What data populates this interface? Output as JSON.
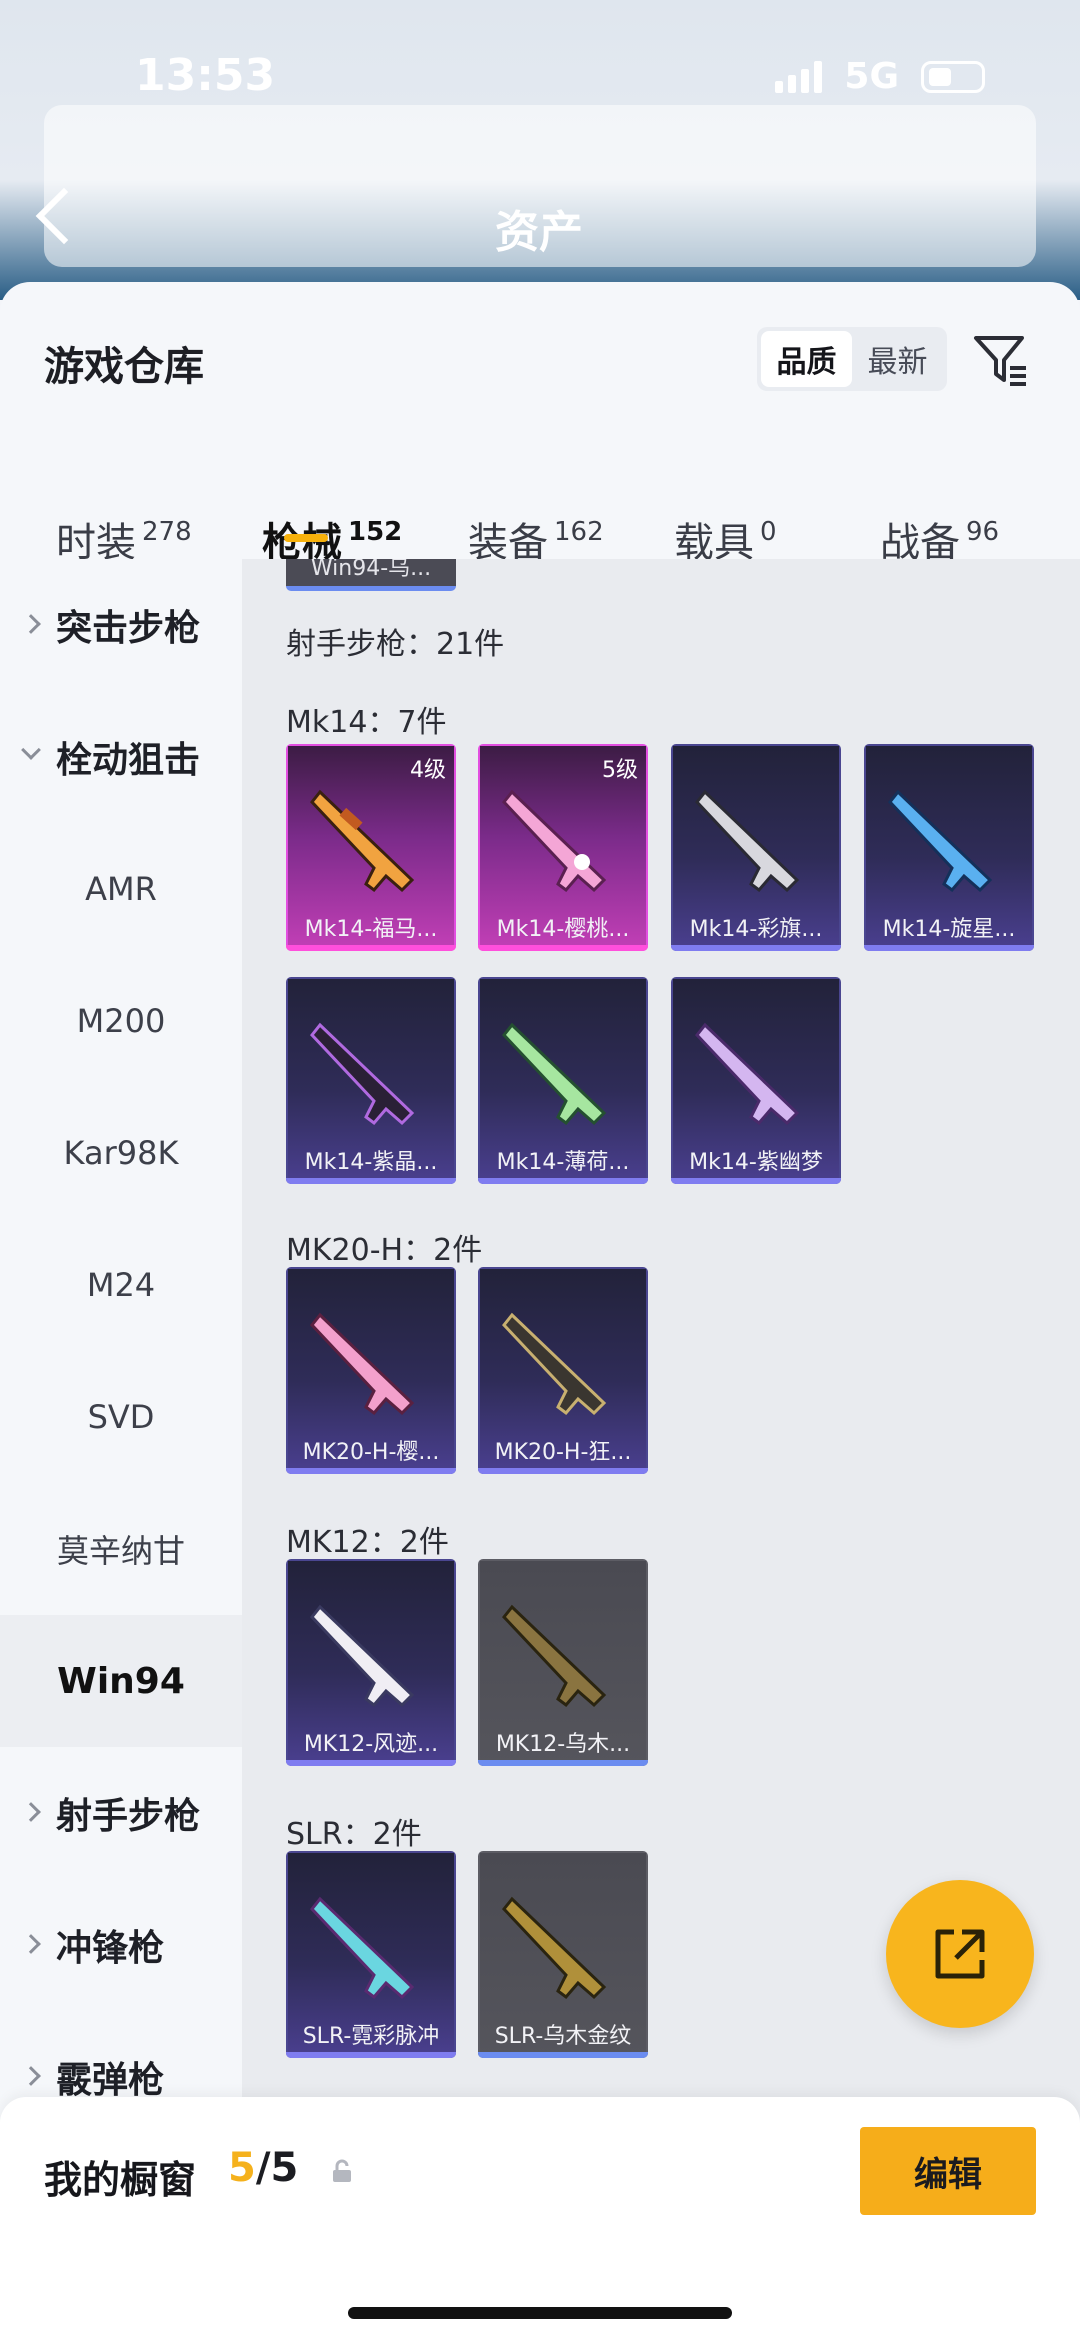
{
  "status_bar": {
    "time": "13:53",
    "network": "5G"
  },
  "header": {
    "title": "资产"
  },
  "sheet": {
    "title": "游戏仓库"
  },
  "sort": {
    "options": [
      "品质",
      "最新"
    ],
    "active": "品质"
  },
  "tabs": [
    {
      "label": "时装",
      "count": "278"
    },
    {
      "label": "枪械",
      "count": "152"
    },
    {
      "label": "装备",
      "count": "162"
    },
    {
      "label": "载具",
      "count": "0"
    },
    {
      "label": "战备",
      "count": "96"
    }
  ],
  "active_tab": "枪械",
  "sidebar": {
    "cat_assault": "突击步枪",
    "cat_bolt": "栓动狙击",
    "subs": [
      "AMR",
      "M200",
      "Kar98K",
      "M24",
      "SVD",
      "莫辛纳甘",
      "Win94"
    ],
    "selected": "Win94",
    "cat_dmr": "射手步枪",
    "cat_smg": "冲锋枪",
    "cat_shotgun": "霰弹枪"
  },
  "content": {
    "peek_card": "Win94-乌...",
    "category_heading": "射手步枪：21件",
    "groups": [
      {
        "label": "Mk14：7件"
      },
      {
        "label": "MK20-H：2件"
      },
      {
        "label": "MK12：2件"
      },
      {
        "label": "SLR：2件"
      }
    ],
    "items": [
      {
        "name": "Mk14-福马...",
        "level": "4级",
        "rarity": "pink"
      },
      {
        "name": "Mk14-樱桃...",
        "level": "5级",
        "rarity": "pink"
      },
      {
        "name": "Mk14-彩旗...",
        "rarity": "purple"
      },
      {
        "name": "Mk14-旋星...",
        "rarity": "purple"
      },
      {
        "name": "Mk14-紫晶...",
        "rarity": "purple"
      },
      {
        "name": "Mk14-薄荷...",
        "rarity": "purple"
      },
      {
        "name": "Mk14-紫幽梦",
        "rarity": "purple"
      },
      {
        "name": "MK20-H-樱...",
        "rarity": "purple"
      },
      {
        "name": "MK20-H-狂...",
        "rarity": "purple"
      },
      {
        "name": "MK12-风迹...",
        "rarity": "purple"
      },
      {
        "name": "MK12-乌木...",
        "rarity": "gray"
      },
      {
        "name": "SLR-霓彩脉冲",
        "rarity": "purple"
      },
      {
        "name": "SLR-乌木金纹",
        "rarity": "gray"
      }
    ]
  },
  "bottom": {
    "label": "我的橱窗",
    "current": "5",
    "separator": "/",
    "total": "5",
    "edit": "编辑"
  },
  "colors": {
    "accent": "#f8b51d",
    "pink_rarity": "#e24ee0",
    "purple_rarity": "#7f7cf0"
  }
}
